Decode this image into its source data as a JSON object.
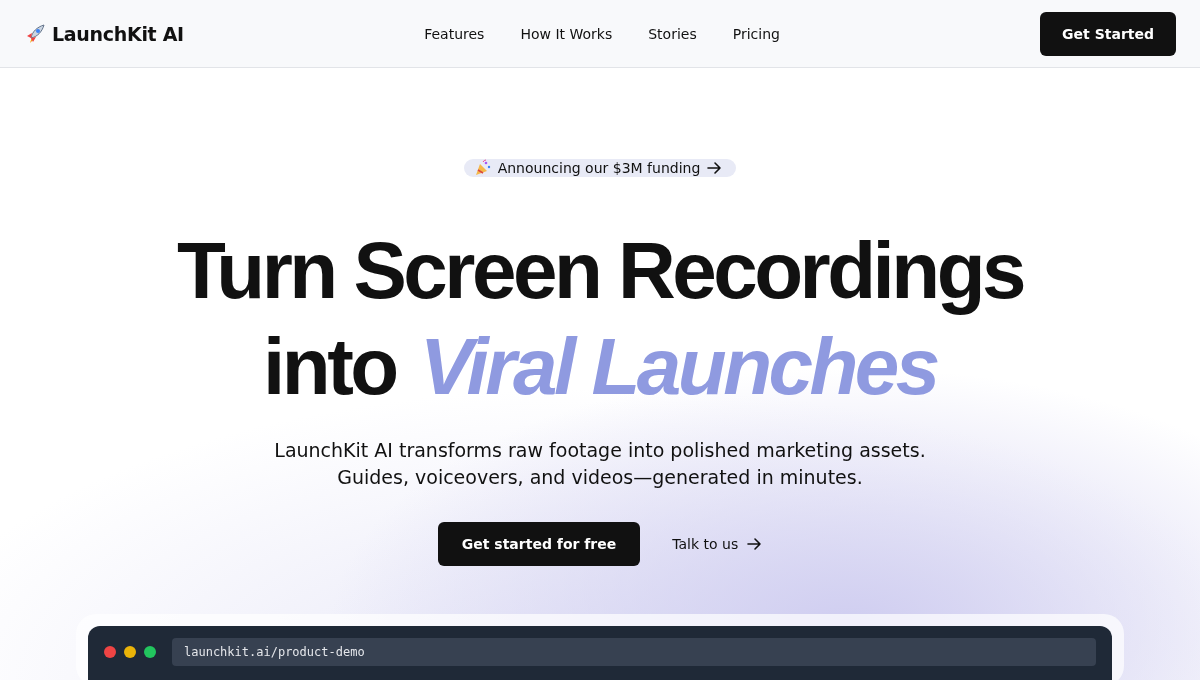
{
  "nav": {
    "brand": "LaunchKit AI",
    "links": [
      "Features",
      "How It Works",
      "Stories",
      "Pricing"
    ],
    "cta": "Get Started"
  },
  "hero": {
    "badge": "Announcing our $3M funding",
    "title_line_1": "Turn Screen Recordings",
    "title_line_2_plain": "into",
    "title_line_2_accent": "Viral Launches",
    "subtitle": [
      "LaunchKit AI transforms raw footage into polished marketing assets.",
      "Guides, voiceovers, and videos—generated in minutes."
    ],
    "primary_button": "Get started for free",
    "secondary_link": "Talk to us"
  },
  "demo": {
    "window_dots": [
      {
        "color": "#ef4444"
      },
      {
        "color": "#eab308"
      },
      {
        "color": "#22c55e"
      }
    ],
    "address": "launchkit.ai/product-demo"
  }
}
